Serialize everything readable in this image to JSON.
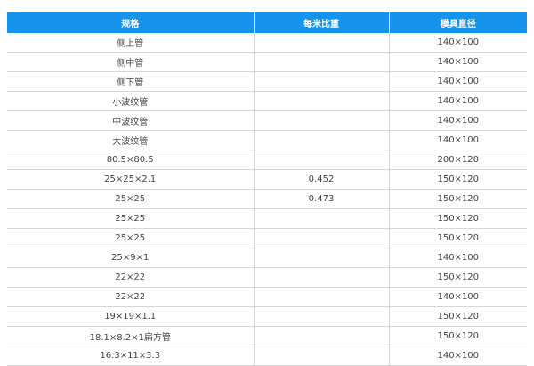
{
  "table": {
    "headers": [
      "规格",
      "每米比重",
      "模具直径"
    ],
    "rows": [
      [
        "侧上管",
        "",
        "140×100"
      ],
      [
        "侧中管",
        "",
        "140×100"
      ],
      [
        "侧下管",
        "",
        "140×100"
      ],
      [
        "小波纹管",
        "",
        "140×100"
      ],
      [
        "中波纹管",
        "",
        "140×100"
      ],
      [
        "大波纹管",
        "",
        "140×100"
      ],
      [
        "80.5×80.5",
        "",
        "200×120"
      ],
      [
        "25×25×2.1",
        "0.452",
        "150×120"
      ],
      [
        "25×25",
        "0.473",
        "150×120"
      ],
      [
        "25×25",
        "",
        "150×120"
      ],
      [
        "25×25",
        "",
        "150×120"
      ],
      [
        "25×9×1",
        "",
        "140×100"
      ],
      [
        "22×22",
        "",
        "150×120"
      ],
      [
        "22×22",
        "",
        "140×100"
      ],
      [
        "19×19×1.1",
        "",
        "150×120"
      ],
      [
        "18.1×8.2×1扁方管",
        "",
        "150×120"
      ],
      [
        "16.3×11×3.3",
        "",
        "140×100"
      ]
    ]
  }
}
